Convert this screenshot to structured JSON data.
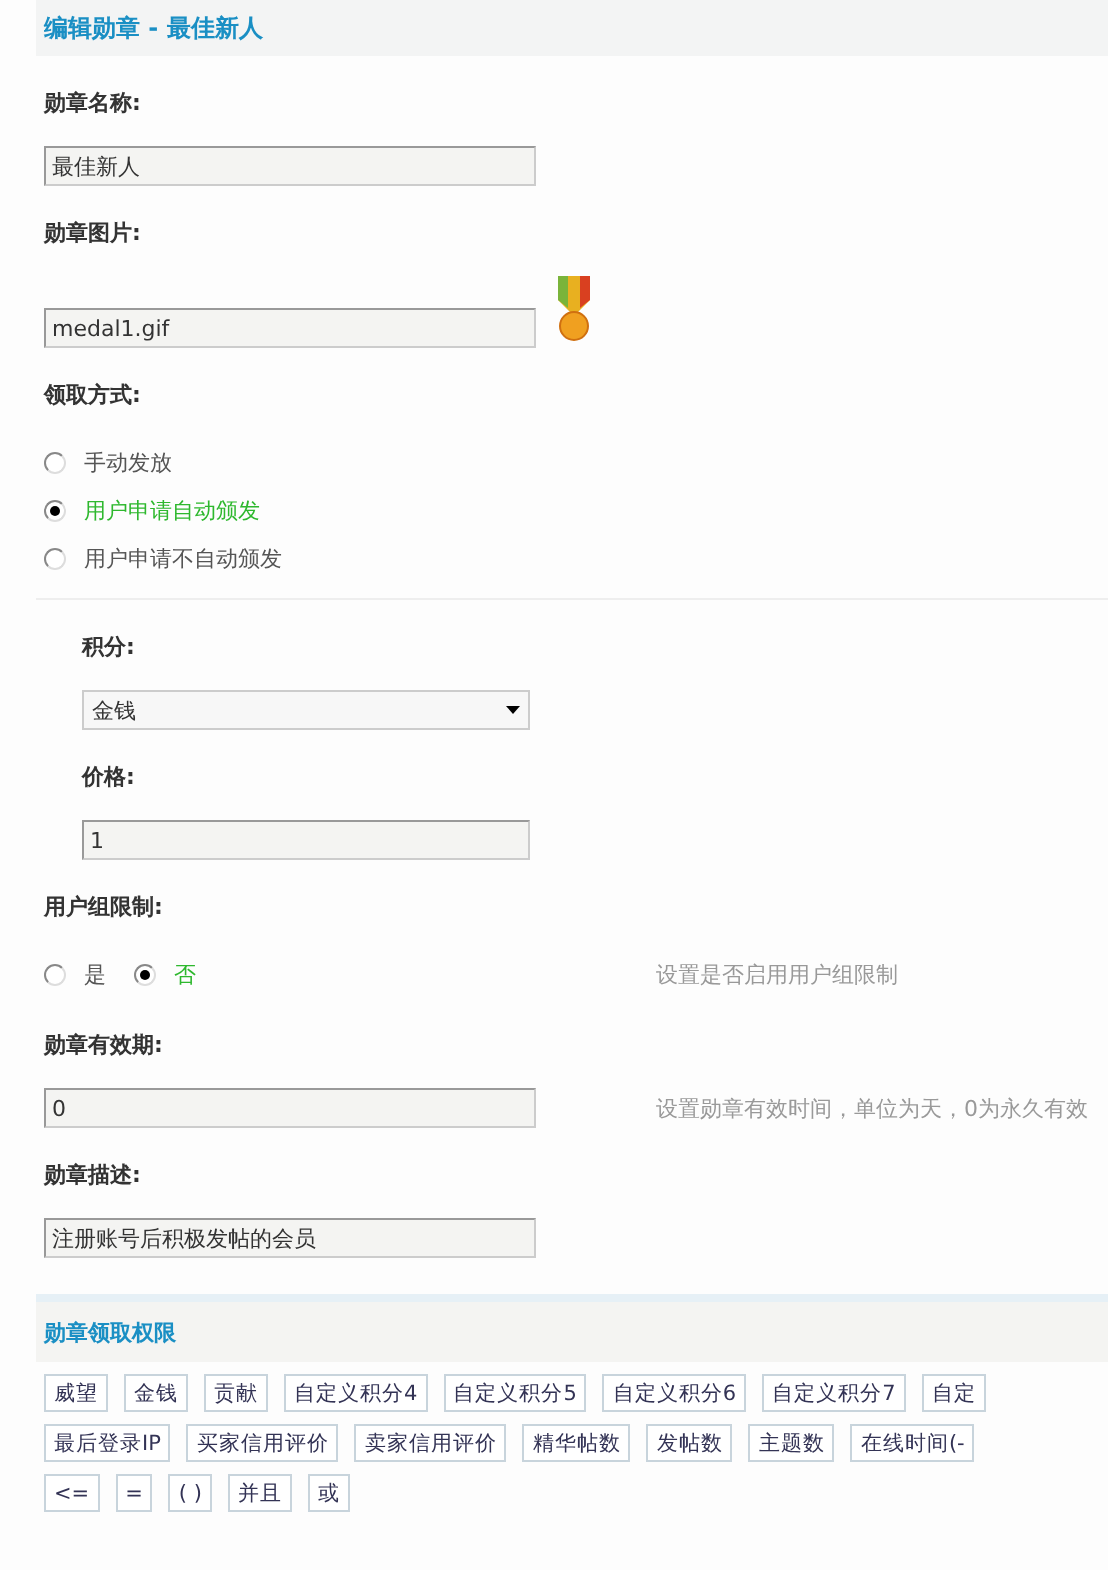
{
  "title": "编辑勋章 - 最佳新人",
  "name_field": {
    "label": "勋章名称:",
    "value": "最佳新人"
  },
  "image_field": {
    "label": "勋章图片:",
    "value": "medal1.gif"
  },
  "method": {
    "label": "领取方式:",
    "options": [
      {
        "label": "手动发放",
        "selected": false
      },
      {
        "label": "用户申请自动颁发",
        "selected": true
      },
      {
        "label": "用户申请不自动颁发",
        "selected": false
      }
    ]
  },
  "credit": {
    "label": "积分:",
    "value": "金钱"
  },
  "price": {
    "label": "价格:",
    "value": "1"
  },
  "group_limit": {
    "label": "用户组限制:",
    "options": [
      {
        "label": "是",
        "selected": false
      },
      {
        "label": "否",
        "selected": true
      }
    ],
    "hint": "设置是否启用用户组限制"
  },
  "expiry": {
    "label": "勋章有效期:",
    "value": "0",
    "hint": "设置勋章有效时间，单位为天，0为永久有效"
  },
  "description": {
    "label": "勋章描述:",
    "value": "注册账号后积极发帖的会员"
  },
  "permissions": {
    "title": "勋章领取权限",
    "buttons": [
      {
        "label": "威望",
        "kind": "credit"
      },
      {
        "label": "金钱",
        "kind": "credit"
      },
      {
        "label": "贡献",
        "kind": "credit"
      },
      {
        "label": "自定义积分4",
        "kind": "credit"
      },
      {
        "label": "自定义积分5",
        "kind": "credit"
      },
      {
        "label": "自定义积分6",
        "kind": "credit"
      },
      {
        "label": "自定义积分7",
        "kind": "credit"
      },
      {
        "label": "自定",
        "kind": "credit"
      },
      {
        "label": "最后登录IP",
        "kind": "stat"
      },
      {
        "label": "买家信用评价",
        "kind": "stat"
      },
      {
        "label": "卖家信用评价",
        "kind": "stat"
      },
      {
        "label": "精华帖数",
        "kind": "stat"
      },
      {
        "label": "发帖数",
        "kind": "stat"
      },
      {
        "label": "主题数",
        "kind": "stat"
      },
      {
        "label": "在线时间(-",
        "kind": "stat"
      },
      {
        "label": "<=",
        "kind": "operator"
      },
      {
        "label": "=",
        "kind": "operator"
      },
      {
        "label": "( )",
        "kind": "operator"
      },
      {
        "label": "并且",
        "kind": "operator"
      },
      {
        "label": "或",
        "kind": "operator"
      }
    ]
  }
}
